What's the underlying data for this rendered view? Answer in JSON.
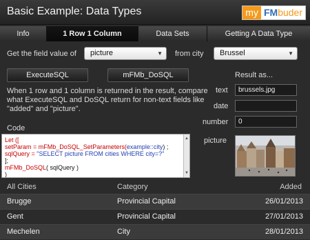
{
  "header": {
    "title": "Basic Example: Data Types",
    "logo_my": "my",
    "logo_fm": "FM",
    "logo_buder": "buder"
  },
  "tabs": [
    {
      "label": "Info",
      "active": false
    },
    {
      "label": "1 Row 1 Column",
      "active": true
    },
    {
      "label": "Data Sets",
      "active": false
    },
    {
      "label": "Getting A Data Type",
      "active": false
    }
  ],
  "query": {
    "field_label": "Get the field value of",
    "field_value": "picture",
    "city_label": "from city",
    "city_value": "Brussel"
  },
  "buttons": {
    "executesql": "ExecuteSQL",
    "dosql": "mFMb_DoSQL"
  },
  "result": {
    "heading": "Result as...",
    "text_label": "text",
    "text_value": "brussels.jpg",
    "date_label": "date",
    "date_value": "",
    "number_label": "number",
    "number_value": "0",
    "picture_label": "picture"
  },
  "description": "When 1 row and 1 column is returned in the result, compare what ExecuteSQL and DoSQL return for non-text fields like \"added\" and \"picture\".",
  "code": {
    "label": "Code",
    "line1": "Let ([",
    "line2a": "setParam = ",
    "line2b": "mFMb_DoSQL_SetParameters(",
    "line2c": "example::city",
    "line2d": ") ;",
    "line3a": "sqlQuery = ",
    "line3b": "\"SELECT picture FROM cities WHERE city=?\"",
    "line4": "];",
    "line5a": "mFMb_DoSQL",
    "line5b": "( sqlQuery )",
    "line6": ")"
  },
  "table": {
    "headers": {
      "city": "All Cities",
      "category": "Category",
      "added": "Added"
    },
    "rows": [
      {
        "city": "Brugge",
        "category": "Provincial Capital",
        "added": "26/01/2013"
      },
      {
        "city": "Gent",
        "category": "Provincial Capital",
        "added": "27/01/2013"
      },
      {
        "city": "Mechelen",
        "category": "City",
        "added": "28/01/2013"
      }
    ]
  },
  "colors": {
    "accent_orange": "#f59a1b",
    "logo_blue": "#2f6db5",
    "code_red": "#c80000",
    "code_blue": "#2440b0"
  }
}
